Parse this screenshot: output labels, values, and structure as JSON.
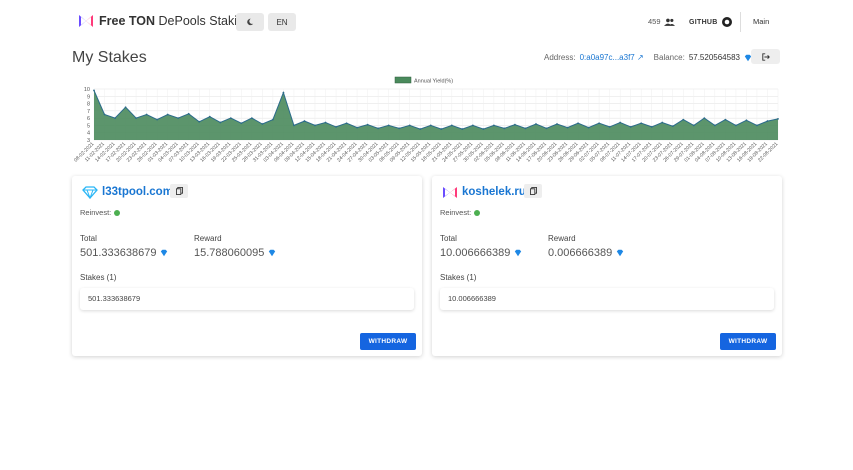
{
  "header": {
    "brand_bold": "Free TON",
    "brand_rest": " DePools Staking",
    "theme_icon": "moon-icon",
    "lang_label": "EN",
    "user_count": "459",
    "github_label": "GITHUB",
    "main_label": "Main"
  },
  "page": {
    "title": "My Stakes",
    "address_label": "Address:",
    "address_value": "0:a0a97c...a3f7",
    "balance_label": "Balance:",
    "balance_value": "57.520564583"
  },
  "colors": {
    "accent": "#1976d2",
    "chart_fill": "#4a8a5c",
    "chart_line": "#2b6b8a",
    "button": "#1565e0",
    "status_green": "#4caf50"
  },
  "chart_data": {
    "type": "area",
    "legend": "Annual Yield(%)",
    "ylim": [
      3,
      10
    ],
    "yticks": [
      "3",
      "4",
      "5",
      "6",
      "7",
      "8",
      "9",
      "10"
    ],
    "x": [
      "08-02-2021",
      "11-02-2021",
      "14-02-2021",
      "17-02-2021",
      "20-02-2021",
      "23-02-2021",
      "26-02-2021",
      "01-03-2021",
      "04-03-2021",
      "07-03-2021",
      "10-03-2021",
      "13-03-2021",
      "16-03-2021",
      "19-03-2021",
      "22-03-2021",
      "25-03-2021",
      "28-03-2021",
      "31-03-2021",
      "03-04-2021",
      "06-04-2021",
      "09-04-2021",
      "12-04-2021",
      "15-04-2021",
      "18-04-2021",
      "21-04-2021",
      "24-04-2021",
      "27-04-2021",
      "30-04-2021",
      "03-05-2021",
      "06-05-2021",
      "09-05-2021",
      "12-05-2021",
      "15-05-2021",
      "18-05-2021",
      "21-05-2021",
      "24-05-2021",
      "27-05-2021",
      "30-05-2021",
      "02-06-2021",
      "05-06-2021",
      "08-06-2021",
      "11-06-2021",
      "14-06-2021",
      "17-06-2021",
      "20-06-2021",
      "23-06-2021",
      "26-06-2021",
      "29-06-2021",
      "02-07-2021",
      "05-07-2021",
      "08-07-2021",
      "11-07-2021",
      "14-07-2021",
      "17-07-2021",
      "20-07-2021",
      "23-07-2021",
      "26-07-2021",
      "29-07-2021",
      "01-08-2021",
      "04-08-2021",
      "07-08-2021",
      "10-08-2021",
      "13-08-2021",
      "16-08-2021",
      "19-08-2021",
      "22-08-2021"
    ],
    "values": [
      9.8,
      6.5,
      6.0,
      7.5,
      6.0,
      6.5,
      5.8,
      6.5,
      6.0,
      6.6,
      5.5,
      6.2,
      5.4,
      6.0,
      5.3,
      6.0,
      5.2,
      5.8,
      9.5,
      5.0,
      5.6,
      5.0,
      5.4,
      4.8,
      5.3,
      4.7,
      5.1,
      4.6,
      5.0,
      4.6,
      5.0,
      4.5,
      5.0,
      4.5,
      5.0,
      4.5,
      5.0,
      4.5,
      5.0,
      4.6,
      5.1,
      4.6,
      5.2,
      4.6,
      5.2,
      4.7,
      5.3,
      4.7,
      5.3,
      4.8,
      5.4,
      4.8,
      5.3,
      4.8,
      5.4,
      4.9,
      5.8,
      5.0,
      6.0,
      5.0,
      5.8,
      5.0,
      5.7,
      5.0,
      5.6,
      5.9
    ]
  },
  "cards": [
    {
      "name": "l33tpool.com",
      "icon": "diamond-icon",
      "reinvest_label": "Reinvest:",
      "total_label": "Total",
      "total_value": "501.333638679",
      "reward_label": "Reward",
      "reward_value": "15.788060095",
      "stakes_label": "Stakes (1)",
      "stake_amount": "501.333638679",
      "withdraw_label": "WITHDRAW"
    },
    {
      "name": "koshelek.ru",
      "icon": "koshelek-logo-icon",
      "reinvest_label": "Reinvest:",
      "total_label": "Total",
      "total_value": "10.006666389",
      "reward_label": "Reward",
      "reward_value": "0.006666389",
      "stakes_label": "Stakes (1)",
      "stake_amount": "10.006666389",
      "withdraw_label": "WITHDRAW"
    }
  ]
}
